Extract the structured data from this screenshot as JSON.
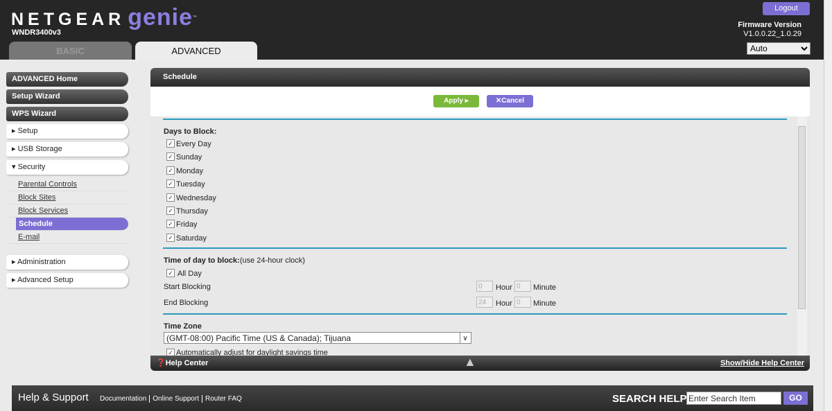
{
  "header": {
    "brand": "NETGEAR",
    "product": "genie",
    "tm": "™",
    "model": "WNDR3400v3",
    "tabs": [
      "BASIC",
      "ADVANCED"
    ],
    "logout": "Logout",
    "firmware_label": "Firmware Version",
    "firmware_value": "V1.0.0.22_1.0.29",
    "language": "Auto"
  },
  "nav": {
    "dark": [
      "ADVANCED Home",
      "Setup Wizard",
      "WPS Wizard"
    ],
    "sections": [
      "▸ Setup",
      "▸ USB Storage",
      "▾ Security"
    ],
    "security_items": [
      "Parental Controls",
      "Block Sites",
      "Block Services",
      "Schedule",
      "E-mail"
    ],
    "more": [
      "▸ Administration",
      "▸ Advanced Setup"
    ]
  },
  "panel": {
    "title": "Schedule",
    "apply": "Apply ▸",
    "cancel": "✕Cancel",
    "days_label": "Days to Block:",
    "days": [
      "Every Day",
      "Sunday",
      "Monday",
      "Tuesday",
      "Wednesday",
      "Thursday",
      "Friday",
      "Saturday"
    ],
    "time_label": "Time of day to block:",
    "time_note": "(use 24-hour clock)",
    "all_day": "All Day",
    "start": "Start Blocking",
    "end": "End Blocking",
    "start_hour": "0",
    "start_min": "0",
    "end_hour": "24",
    "end_min": "0",
    "hour": "Hour",
    "minute": "Minute",
    "tz_label": "Time Zone",
    "tz_value": "(GMT-08:00) Pacific Time (US & Canada); Tijuana",
    "dst": "Automatically adjust for daylight savings time",
    "help_center": "Help Center",
    "show_hide": "Show/Hide Help Center"
  },
  "footer": {
    "title": "Help & Support",
    "links": [
      "Documentation",
      "Online Support",
      "Router FAQ"
    ],
    "search_label": "SEARCH HELP",
    "search_placeholder": "Enter Search Item",
    "go": "GO"
  }
}
